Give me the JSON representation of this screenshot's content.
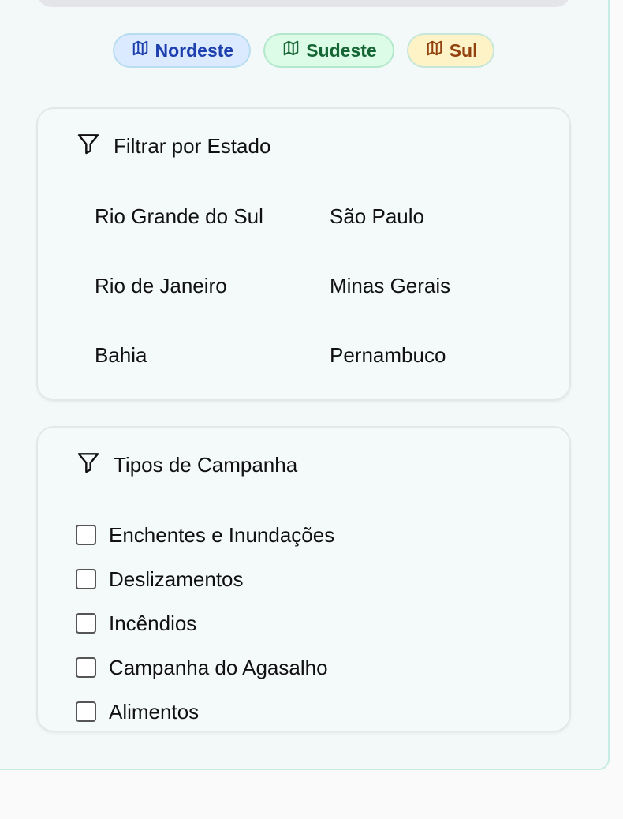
{
  "regions": [
    {
      "label": "Nordeste",
      "icon": "map-icon",
      "color": "#1e40af",
      "background": "#dbeafe"
    },
    {
      "label": "Sudeste",
      "icon": "map-icon",
      "color": "#166534",
      "background": "#dcfce7"
    },
    {
      "label": "Sul",
      "icon": "map-icon",
      "color": "#92400e",
      "background": "#fef3c7"
    }
  ],
  "state_filter": {
    "title": "Filtrar por Estado",
    "icon": "filter-icon",
    "states": [
      "Rio Grande do Sul",
      "São Paulo",
      "Rio de Janeiro",
      "Minas Gerais",
      "Bahia",
      "Pernambuco"
    ]
  },
  "campaign_filter": {
    "title": "Tipos de Campanha",
    "icon": "filter-icon",
    "types": [
      {
        "label": "Enchentes e Inundações",
        "checked": false
      },
      {
        "label": "Deslizamentos",
        "checked": false
      },
      {
        "label": "Incêndios",
        "checked": false
      },
      {
        "label": "Campanha do Agasalho",
        "checked": false
      },
      {
        "label": "Alimentos",
        "checked": false
      }
    ]
  }
}
